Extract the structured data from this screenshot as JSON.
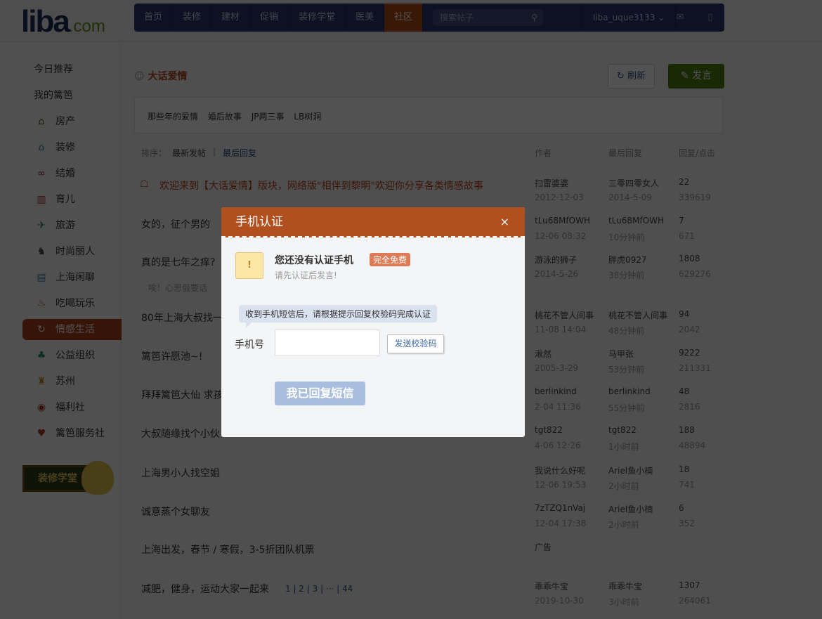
{
  "header": {
    "logo": "liba",
    "logo_suffix": ".com",
    "nav": [
      "首页",
      "装修",
      "建材",
      "促销",
      "装修学堂",
      "医美",
      "社区"
    ],
    "active_nav": "社区",
    "search_placeholder": "搜索帖子",
    "username": "liba_uque3133"
  },
  "sidebar": {
    "items": [
      {
        "label": "今日推荐",
        "icon": ""
      },
      {
        "label": "我的篱笆",
        "icon": ""
      },
      {
        "label": "房产",
        "icon": "⌂",
        "color": "#3d5d1e"
      },
      {
        "label": "装修",
        "icon": "⌂",
        "color": "#2a7a8a"
      },
      {
        "label": "结婚",
        "icon": "∞",
        "color": "#9a2a4a"
      },
      {
        "label": "育儿",
        "icon": "▥",
        "color": "#b03a2a"
      },
      {
        "label": "旅游",
        "icon": "✈",
        "color": "#2a8a6a"
      },
      {
        "label": "时尚丽人",
        "icon": "♞",
        "color": "#444"
      },
      {
        "label": "上海闲聊",
        "icon": "▤",
        "color": "#3a8ab0"
      },
      {
        "label": "吃喝玩乐",
        "icon": "♨",
        "color": "#b03a2a"
      },
      {
        "label": "情感生活",
        "icon": "↻",
        "color": "#fff"
      },
      {
        "label": "公益组织",
        "icon": "♣",
        "color": "#2a8a6a"
      },
      {
        "label": "苏州",
        "icon": "♜",
        "color": "#c8901a"
      },
      {
        "label": "福利社",
        "icon": "◉",
        "color": "#b03a2a"
      },
      {
        "label": "篱笆服务社",
        "icon": "♥",
        "color": "#b03a2a"
      }
    ],
    "active": "情感生活",
    "banner": "装修学堂"
  },
  "board": {
    "title": "大话爱情",
    "refresh": "刷新",
    "post": "发言",
    "subforums": [
      "那些年的爱情",
      "婚后故事",
      "JP两三事",
      "LB树洞"
    ],
    "sort_label": "排序：",
    "sort_new": "最新发帖",
    "sort_sep": "|",
    "sort_reply": "最后回复",
    "col_author": "作者",
    "col_last": "最后回复",
    "col_count": "回复/点击"
  },
  "threads": [
    {
      "title": "欢迎来到【大话爱情】版块，网络版\"相伴到黎明\"欢迎你分享各类情感故事",
      "author": "扫雷婆婆",
      "date": "2012-12-03",
      "last": "三零四零女人",
      "last_time": "2014-5-09",
      "replies": "22",
      "clicks": "339619",
      "sticky": true
    },
    {
      "title": "女的，征个男的",
      "author": "tLu68MfOWH",
      "date": "12-06 08:32",
      "last": "tLu68MfOWH",
      "last_time": "10分钟前",
      "replies": "7",
      "clicks": "671"
    },
    {
      "title": "真的是七年之痒?",
      "sub": "唉！心思俄要话",
      "author": "游泳的狮子",
      "date": "2014-5-26",
      "last": "胖虎0927",
      "last_time": "38分钟前",
      "replies": "1808",
      "clicks": "629276"
    },
    {
      "title": "80年上海大叔找一",
      "author": "桃花不管人间事",
      "date": "11-08 14:04",
      "last": "桃花不管人间事",
      "last_time": "48分钟前",
      "replies": "94",
      "clicks": "2042"
    },
    {
      "title": "篱笆许愿池~!",
      "author": "湫然",
      "date": "2005-3-29",
      "last": "马甲张",
      "last_time": "53分钟前",
      "replies": "9222",
      "clicks": "211331"
    },
    {
      "title": "拜拜篱笆大仙 求孩",
      "author": "berlinkind",
      "date": "2-04 11:36",
      "last": "berlinkind",
      "last_time": "55分钟前",
      "replies": "48",
      "clicks": "2816"
    },
    {
      "title": "大叔随缘找个小伙",
      "author": "tgt822",
      "date": "4-06 12:26",
      "last": "tgt822",
      "last_time": "1小时前",
      "replies": "188",
      "clicks": "48894"
    },
    {
      "title": "上海男小人找空姐",
      "author": "我说什么好呢",
      "date": "12-06 19:53",
      "last": "Ariel鱼小楠",
      "last_time": "2小时前",
      "replies": "18",
      "clicks": "741"
    },
    {
      "title": "诚意蒸个女聊友",
      "author": "7zTZQ1nVaj",
      "date": "12-04 17:38",
      "last": "Ariel鱼小楠",
      "last_time": "2小时前",
      "replies": "6",
      "clicks": "352"
    },
    {
      "title": "上海出发，春节 / 寒假，3-5折团队机票",
      "author": "广告"
    },
    {
      "title": "减肥，健身，运动大家一起来",
      "pages": "1 | 2 | 3 | ··· | 44",
      "author": "乖乖牛宝",
      "date": "2019-10-30",
      "last": "乖乖牛宝",
      "last_time": "3小时前",
      "replies": "1307",
      "clicks": "264061"
    }
  ],
  "modal": {
    "title": "手机认证",
    "close": "×",
    "warn_icon": "!",
    "heading": "您还没有认证手机",
    "badge": "完全免费",
    "subtext": "请先认证后发言!",
    "tip": "收到手机短信后，请根据提示回复校验码完成认证",
    "phone_label": "手机号",
    "phone_value": "",
    "send_code": "发送校验码",
    "confirm": "我已回复短信"
  }
}
